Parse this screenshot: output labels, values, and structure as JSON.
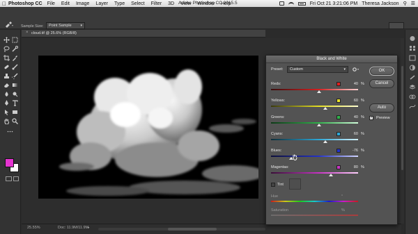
{
  "menubar": {
    "app_name": "Photoshop CC",
    "items": [
      "File",
      "Edit",
      "Image",
      "Layer",
      "Type",
      "Select",
      "Filter",
      "3D",
      "View",
      "Window",
      "Help"
    ],
    "window_title": "Adobe Photoshop CC 2015.5",
    "clock": "Fri Oct 21  3:21:06 PM",
    "user": "Theresa Jackson"
  },
  "options_bar": {
    "sample_size_label": "Sample Size:",
    "sample_size_value": "Point Sample"
  },
  "document": {
    "tab_title": "cloud.tif @ 25.6% (RGB/8)",
    "zoom": "25.55%",
    "doc_info": "Doc: 11.9M/11.9M"
  },
  "dialog": {
    "title": "Black and White",
    "preset_label": "Preset:",
    "preset_value": "Custom",
    "ok_label": "OK",
    "cancel_label": "Cancel",
    "auto_label": "Auto",
    "preview_label": "Preview",
    "preview_checked": true,
    "channels": [
      {
        "label": "Reds:",
        "value": "40",
        "unit": "%",
        "color": "#e01f1f",
        "slider": 0.55
      },
      {
        "label": "Yellows:",
        "value": "60",
        "unit": "%",
        "color": "#e8e22a",
        "slider": 0.62
      },
      {
        "label": "Greens:",
        "value": "40",
        "unit": "%",
        "color": "#2fb24a",
        "slider": 0.55
      },
      {
        "label": "Cyans:",
        "value": "60",
        "unit": "%",
        "color": "#2ea7d6",
        "slider": 0.62
      },
      {
        "label": "Blues:",
        "value": "-76",
        "unit": "%",
        "color": "#2432c8",
        "slider": 0.23
      },
      {
        "label": "Magentas:",
        "value": "80",
        "unit": "%",
        "color": "#c833c4",
        "slider": 0.69
      }
    ],
    "tint_label": "Tint",
    "tint_checked": false,
    "hue_label": "Hue",
    "hue_unit": "°",
    "saturation_label": "Saturation",
    "saturation_unit": "%"
  },
  "colors": {
    "foreground": "#e534d0",
    "background": "#ffffff"
  }
}
